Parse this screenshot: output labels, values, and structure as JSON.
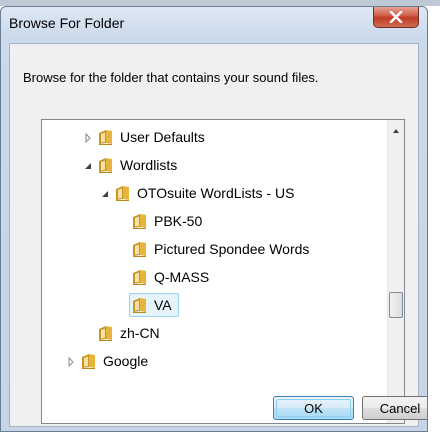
{
  "window": {
    "title": "Browse For Folder",
    "close_icon": "close-icon"
  },
  "dialog": {
    "instruction": "Browse for the folder that contains your sound files."
  },
  "tree": {
    "items": [
      {
        "label": "User Defaults",
        "expander": "collapsed",
        "depth": 1
      },
      {
        "label": "Wordlists",
        "expander": "expanded",
        "depth": 1
      },
      {
        "label": "OTOsuite WordLists - US",
        "expander": "expanded",
        "depth": 2
      },
      {
        "label": "PBK-50",
        "expander": "none",
        "depth": 3
      },
      {
        "label": "Pictured Spondee Words",
        "expander": "none",
        "depth": 3
      },
      {
        "label": "Q-MASS",
        "expander": "none",
        "depth": 3
      },
      {
        "label": "VA",
        "expander": "none",
        "depth": 3,
        "selected": true
      },
      {
        "label": "zh-CN",
        "expander": "none",
        "depth": 1
      },
      {
        "label": "Google",
        "expander": "collapsed",
        "depth": 0
      }
    ]
  },
  "buttons": {
    "ok": "OK",
    "cancel": "Cancel"
  },
  "colors": {
    "folder": "#e7b53d",
    "selection": "#e5f3fb",
    "close_button": "#c94a32"
  }
}
